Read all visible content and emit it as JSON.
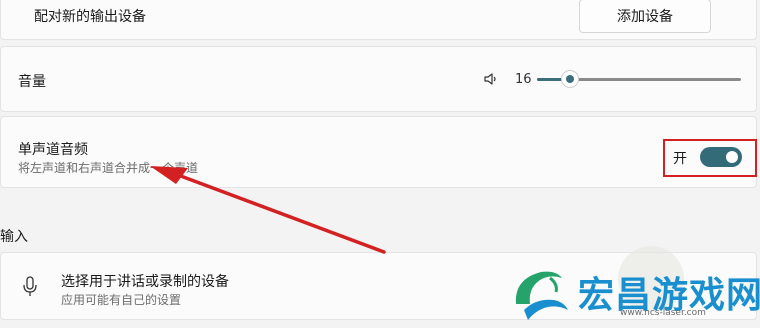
{
  "pair_device": {
    "label": "配对新的输出设备",
    "button_label": "添加设备"
  },
  "volume": {
    "label": "音量",
    "value": "16",
    "level_percent": 16
  },
  "mono_audio": {
    "label": "单声道音频",
    "description": "将左声道和右声道合并成一个声道",
    "toggle_label": "开",
    "toggle_on": true
  },
  "input_section": {
    "title": "输入",
    "device_label": "选择用于讲话或录制的设备",
    "device_description": "应用可能有自己的设置"
  },
  "watermark": {
    "text": "宏昌游戏网",
    "url": "www.hcs-laser.com"
  },
  "colors": {
    "accent": "#336b78",
    "annotation_red": "#d32020",
    "watermark_blue": "#1a8fd0"
  }
}
